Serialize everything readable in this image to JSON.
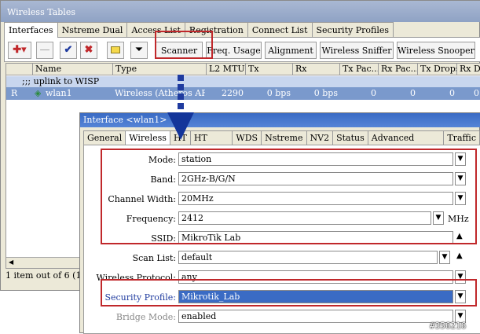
{
  "bg_window": {
    "title": "Wireless Tables",
    "tabs": [
      "Interfaces",
      "Nstreme Dual",
      "Access List",
      "Registration",
      "Connect List",
      "Security Profiles"
    ],
    "toolbar": {
      "icons": [
        "add-icon",
        "remove-icon",
        "enable-check-icon",
        "disable-x-icon",
        "comment-icon",
        "filter-icon"
      ],
      "buttons": [
        "Scanner",
        "Freq. Usage",
        "Alignment",
        "Wireless Sniffer",
        "Wireless Snooper"
      ]
    },
    "columns": [
      "",
      "Name",
      "Type",
      "L2 MTU",
      "Tx",
      "Rx",
      "Tx Pac...",
      "Rx Pac...",
      "Tx Drops",
      "Rx Dr..."
    ],
    "group_row": ";;; uplink to WISP",
    "row": {
      "flag": "R",
      "name": "wlan1",
      "type": "Wireless (Atheros AR...",
      "l2mtu": "2290",
      "tx": "0 bps",
      "rx": "0 bps",
      "tx_pac": "0",
      "rx_pac": "0",
      "tx_drops": "0",
      "rx_drops": "0"
    },
    "status": "1 item out of 6 (1 s"
  },
  "editor": {
    "title": "Interface <wlan1>",
    "tabs": [
      "General",
      "Wireless",
      "HT",
      "HT MCS",
      "WDS",
      "Nstreme",
      "NV2",
      "Status",
      "Advanced Status",
      "Traffic"
    ],
    "fields": {
      "mode": {
        "label": "Mode:",
        "value": "station"
      },
      "band": {
        "label": "Band:",
        "value": "2GHz-B/G/N"
      },
      "channel_width": {
        "label": "Channel Width:",
        "value": "20MHz"
      },
      "frequency": {
        "label": "Frequency:",
        "value": "2412",
        "unit": "MHz"
      },
      "ssid": {
        "label": "SSID:",
        "value": "MikroTik Lab"
      },
      "scan_list": {
        "label": "Scan List:",
        "value": "default"
      },
      "wireless_protocol": {
        "label": "Wireless Protocol:",
        "value": "any"
      },
      "security_profile": {
        "label": "Security Profile:",
        "value": "Mikrotik_Lab"
      },
      "bridge_mode": {
        "label": "Bridge Mode:",
        "value": "enabled"
      }
    }
  },
  "watermark": "#356216",
  "colors": {
    "highlight": "#c0282b",
    "arrow": "#1f3b9f",
    "selected_row": "#7a99cc",
    "title_active": "#3a6bc4"
  }
}
